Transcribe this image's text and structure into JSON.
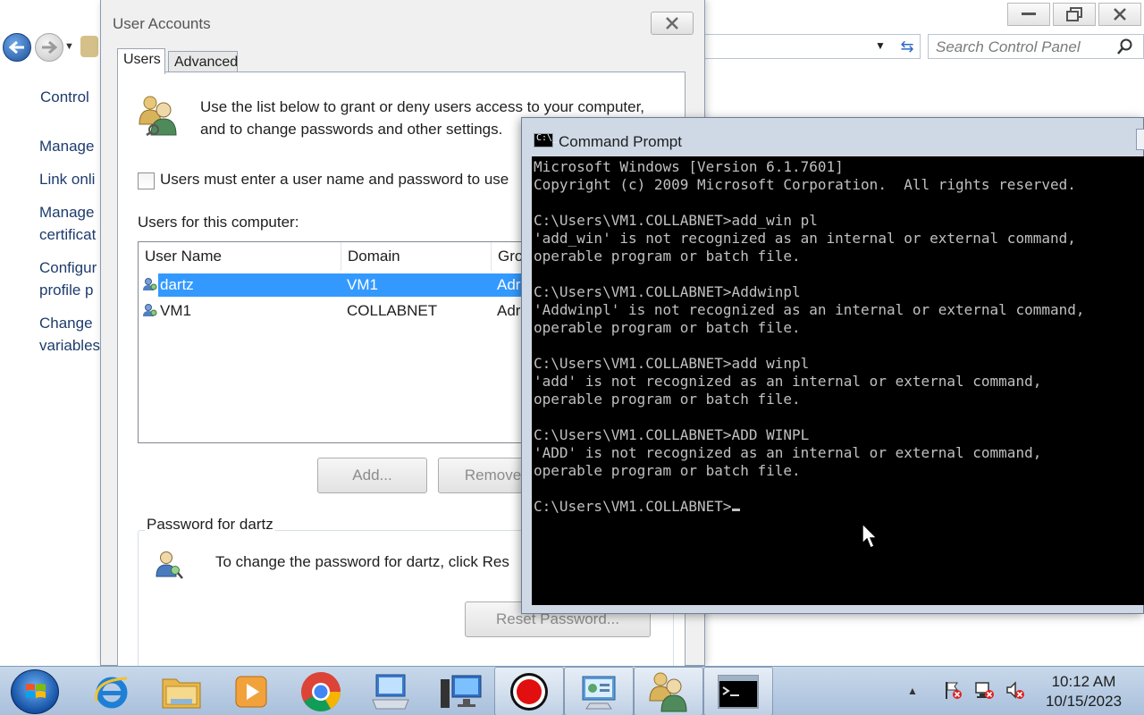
{
  "control_panel": {
    "search_placeholder": "Search Control Panel",
    "heading": "Control",
    "left_links": [
      "Manage",
      "Link onli",
      "Manage",
      "certificat",
      "Configur",
      "profile p",
      "Change",
      "variables"
    ]
  },
  "user_accounts": {
    "title": "User Accounts",
    "tabs": [
      "Users",
      "Advanced"
    ],
    "intro_line1": "Use the list below to grant or deny users access to your computer,",
    "intro_line2": "and to change passwords and other settings.",
    "must_enter_label": "Users must enter a user name and password to use",
    "must_enter_checked": false,
    "users_for_label": "Users for this computer:",
    "columns": [
      "User Name",
      "Domain",
      "Gro"
    ],
    "rows": [
      {
        "user": "dartz",
        "domain": "VM1",
        "group": "Adr",
        "selected": true
      },
      {
        "user": "VM1",
        "domain": "COLLABNET",
        "group": "Adr",
        "selected": false
      }
    ],
    "add_button": "Add...",
    "remove_button": "Remove",
    "password_group_label": "Password for dartz",
    "password_text": "To change the password for dartz, click Res",
    "reset_button": "Reset Password..."
  },
  "command_prompt": {
    "title": "Command Prompt",
    "icon_text": "C:\\_",
    "lines": [
      "Microsoft Windows [Version 6.1.7601]",
      "Copyright (c) 2009 Microsoft Corporation.  All rights reserved.",
      "",
      "C:\\Users\\VM1.COLLABNET>add_win pl",
      "'add_win' is not recognized as an internal or external command,",
      "operable program or batch file.",
      "",
      "C:\\Users\\VM1.COLLABNET>Addwinpl",
      "'Addwinpl' is not recognized as an internal or external command,",
      "operable program or batch file.",
      "",
      "C:\\Users\\VM1.COLLABNET>add winpl",
      "'add' is not recognized as an internal or external command,",
      "operable program or batch file.",
      "",
      "C:\\Users\\VM1.COLLABNET>ADD WINPL",
      "'ADD' is not recognized as an internal or external command,",
      "operable program or batch file.",
      ""
    ],
    "prompt": "C:\\Users\\VM1.COLLABNET>"
  },
  "taskbar": {
    "apps": [
      "internet-explorer-icon",
      "file-explorer-icon",
      "media-player-icon",
      "chrome-icon",
      "remote-desktop-icon",
      "computer-monitor-icon",
      "screen-recorder-icon",
      "control-panel-icon",
      "user-accounts-icon",
      "command-prompt-icon"
    ],
    "time": "10:12 AM",
    "date": "10/15/2023"
  },
  "colors": {
    "selection": "#3399ff",
    "console_bg": "#000000",
    "console_text": "#c0c0c0",
    "link": "#1e3c6e"
  }
}
